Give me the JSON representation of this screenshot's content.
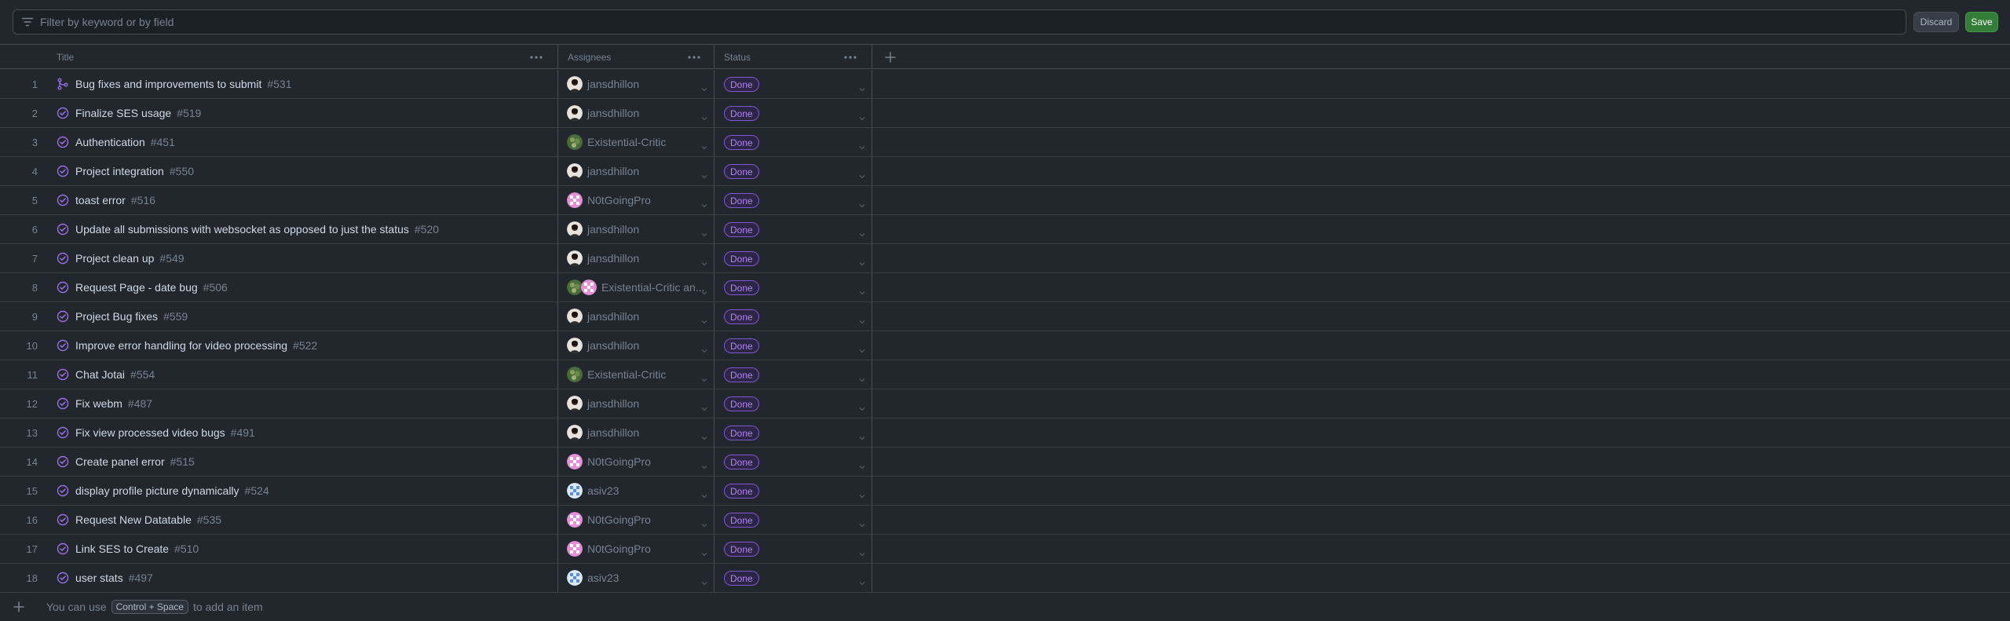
{
  "filter": {
    "placeholder": "Filter by keyword or by field"
  },
  "actions": {
    "discard_label": "Discard",
    "save_label": "Save"
  },
  "columns": {
    "title": "Title",
    "assignees": "Assignees",
    "status": "Status"
  },
  "rows": [
    {
      "num": "1",
      "title": "Bug fixes and improvements to submit",
      "issue": "#531",
      "kind": "merged",
      "assignee": "jansdhillon",
      "avatar": "j",
      "status": "Done"
    },
    {
      "num": "2",
      "title": "Finalize SES usage",
      "issue": "#519",
      "kind": "closed",
      "assignee": "jansdhillon",
      "avatar": "j",
      "status": "Done"
    },
    {
      "num": "3",
      "title": "Authentication",
      "issue": "#451",
      "kind": "closed",
      "assignee": "Existential-Critic",
      "avatar": "e",
      "status": "Done"
    },
    {
      "num": "4",
      "title": "Project integration",
      "issue": "#550",
      "kind": "closed",
      "assignee": "jansdhillon",
      "avatar": "j",
      "status": "Done"
    },
    {
      "num": "5",
      "title": "toast error",
      "issue": "#516",
      "kind": "closed",
      "assignee": "N0tGoingPro",
      "avatar": "n",
      "status": "Done"
    },
    {
      "num": "6",
      "title": "Update all submissions with websocket as opposed to just the status",
      "issue": "#520",
      "kind": "closed",
      "assignee": "jansdhillon",
      "avatar": "j",
      "status": "Done"
    },
    {
      "num": "7",
      "title": "Project clean up",
      "issue": "#549",
      "kind": "closed",
      "assignee": "jansdhillon",
      "avatar": "j",
      "status": "Done"
    },
    {
      "num": "8",
      "title": "Request Page - date bug",
      "issue": "#506",
      "kind": "closed",
      "assignee": "Existential-Critic an...",
      "avatar": "en",
      "status": "Done"
    },
    {
      "num": "9",
      "title": "Project Bug fixes",
      "issue": "#559",
      "kind": "closed",
      "assignee": "jansdhillon",
      "avatar": "j",
      "status": "Done"
    },
    {
      "num": "10",
      "title": "Improve error handling for video processing",
      "issue": "#522",
      "kind": "closed",
      "assignee": "jansdhillon",
      "avatar": "j",
      "status": "Done"
    },
    {
      "num": "11",
      "title": "Chat Jotai",
      "issue": "#554",
      "kind": "closed",
      "assignee": "Existential-Critic",
      "avatar": "e",
      "status": "Done"
    },
    {
      "num": "12",
      "title": "Fix webm",
      "issue": "#487",
      "kind": "closed",
      "assignee": "jansdhillon",
      "avatar": "j",
      "status": "Done"
    },
    {
      "num": "13",
      "title": "Fix view processed video bugs",
      "issue": "#491",
      "kind": "closed",
      "assignee": "jansdhillon",
      "avatar": "j",
      "status": "Done"
    },
    {
      "num": "14",
      "title": "Create panel error",
      "issue": "#515",
      "kind": "closed",
      "assignee": "N0tGoingPro",
      "avatar": "n",
      "status": "Done"
    },
    {
      "num": "15",
      "title": "display profile picture dynamically",
      "issue": "#524",
      "kind": "closed",
      "assignee": "asiv23",
      "avatar": "a",
      "status": "Done"
    },
    {
      "num": "16",
      "title": "Request New Datatable",
      "issue": "#535",
      "kind": "closed",
      "assignee": "N0tGoingPro",
      "avatar": "n",
      "status": "Done"
    },
    {
      "num": "17",
      "title": "Link SES to Create",
      "issue": "#510",
      "kind": "closed",
      "assignee": "N0tGoingPro",
      "avatar": "n",
      "status": "Done"
    },
    {
      "num": "18",
      "title": "user stats",
      "issue": "#497",
      "kind": "closed",
      "assignee": "asiv23",
      "avatar": "a",
      "status": "Done"
    }
  ],
  "footer": {
    "prefix": "You can use",
    "shortcut": "Control + Space",
    "suffix": "to add an item"
  },
  "colors": {
    "done_badge": "#b083f0",
    "save": "#347d39",
    "background": "#22272e"
  },
  "icons": {
    "filter": "filter-icon",
    "merged": "git-merge-icon",
    "closed": "issue-closed-icon",
    "add": "plus-icon",
    "more": "kebab-horizontal-icon"
  }
}
